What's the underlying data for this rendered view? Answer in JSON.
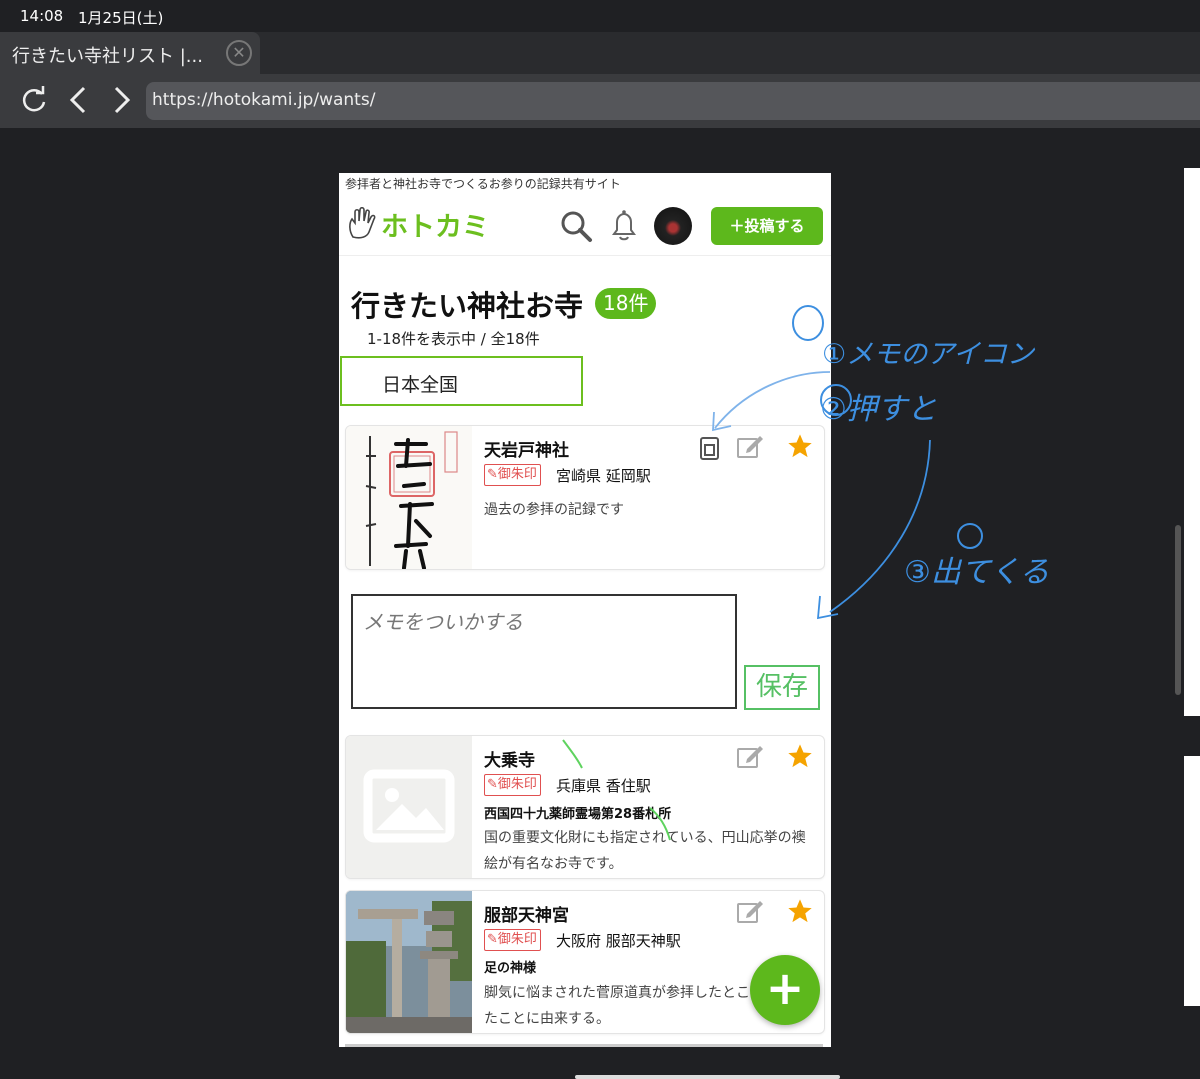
{
  "status_bar": {
    "time": "14:08",
    "date": "1月25日(土)"
  },
  "browser": {
    "tab_title": "行きたい寺社リスト |...",
    "tab_close_glyph": "✕",
    "url": "https://hotokami.jp/wants/",
    "icons": [
      "reload-icon",
      "back-icon",
      "forward-icon"
    ]
  },
  "site": {
    "tagline": "参拝者と神社お寺でつくるお参りの記録共有サイト",
    "logo": "ホトカミ",
    "post_button": "＋投稿する",
    "brand_color": "#5db81c"
  },
  "page": {
    "title": "行きたい神社お寺",
    "count_badge": "18件",
    "showing": "1-18件を表示中 / 全18件",
    "area_filter": "日本全国"
  },
  "cards": [
    {
      "name": "天岩戸神社",
      "tag": "御朱印",
      "location": "宮崎県 延岡駅",
      "desc": "過去の参拝の記録です",
      "starred": true,
      "has_memo_icon": true
    },
    {
      "name": "大乗寺",
      "tag": "御朱印",
      "location": "兵庫県 香住駅",
      "sub": "西国四十九薬師霊場第28番札所",
      "desc_lines": [
        "国の重要文化財にも指定されている、円山応挙の襖",
        "絵が有名なお寺です。"
      ],
      "starred": true
    },
    {
      "name": "服部天神宮",
      "tag": "御朱印",
      "location": "大阪府 服部天神駅",
      "sub": "足の神様",
      "desc_lines": [
        "脚気に悩まされた菅原道真が参拝したとこ",
        "たことに由来する。"
      ],
      "starred": true
    }
  ],
  "memo": {
    "placeholder": "メモをついかする",
    "save": "保存"
  },
  "fab": {
    "label": "+"
  },
  "annotations": {
    "note1": "①メモのアイコン",
    "note2": "②押すと",
    "note3": "③出てくる",
    "ink_color": "#3d8fe0"
  }
}
